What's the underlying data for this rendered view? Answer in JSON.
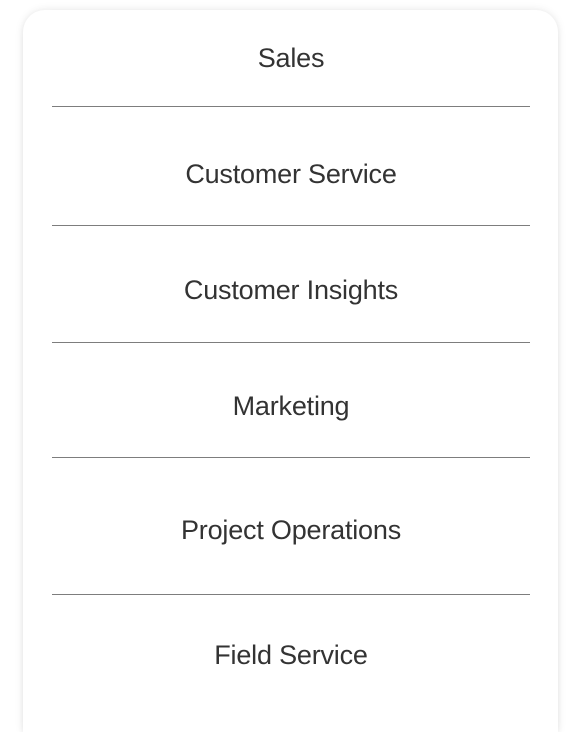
{
  "menu": {
    "items": [
      {
        "label": "Sales"
      },
      {
        "label": "Customer Service"
      },
      {
        "label": "Customer Insights"
      },
      {
        "label": "Marketing"
      },
      {
        "label": "Project Operations"
      },
      {
        "label": "Field Service"
      }
    ]
  },
  "colors": {
    "text": "#333333",
    "divider": "#7d7d7d",
    "background": "#ffffff"
  }
}
